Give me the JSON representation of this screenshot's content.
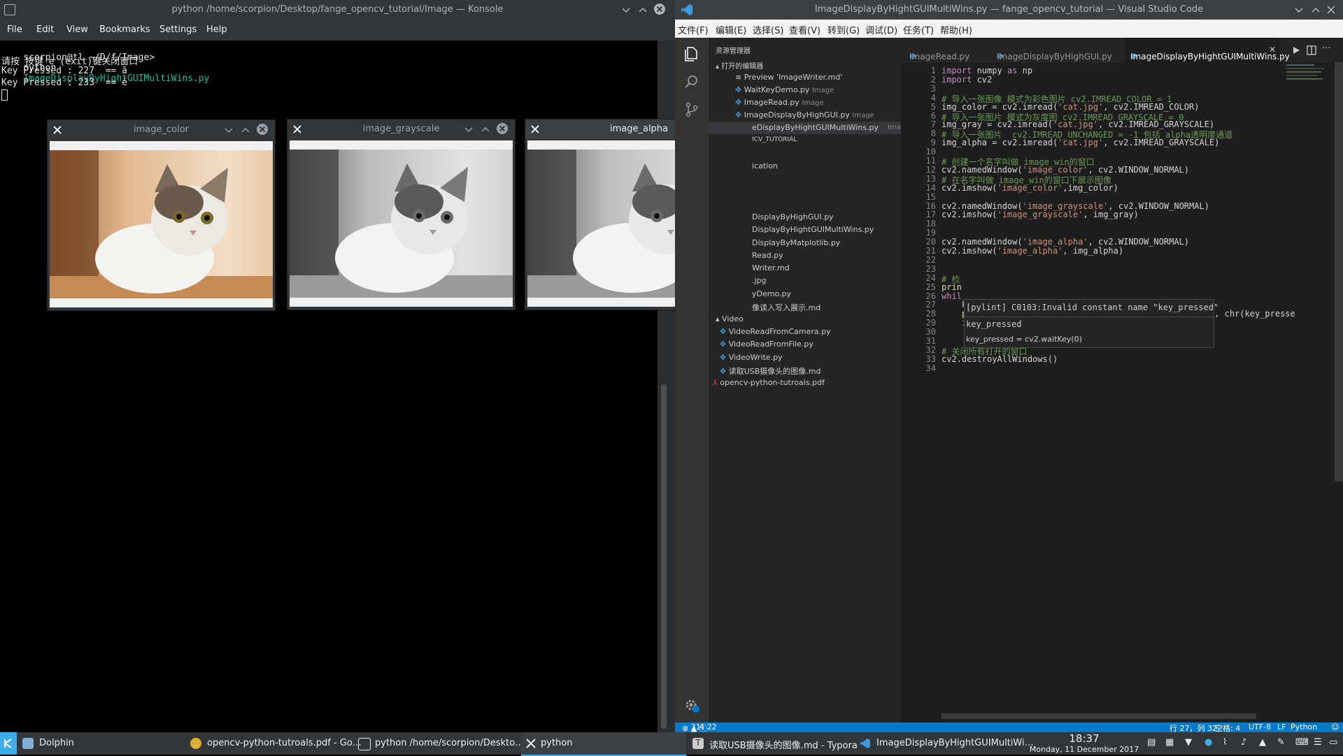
{
  "konsole": {
    "title": "python /home/scorpion/Desktop/fange_opencv_tutorial/Image — Konsole",
    "menu": [
      "File",
      "Edit",
      "View",
      "Bookmarks",
      "Settings",
      "Help"
    ],
    "prompt": "scorpion@tl ~/D/f/Image>",
    "command": "python",
    "command_arg": "ImageDisplayByHightGUIMultiWins.py",
    "output": [
      "请按 按键 e (exit)键关闭窗口",
      "Key Pressed : 227  == ã",
      "Key Pressed : 233  == é"
    ]
  },
  "windows": [
    {
      "title": "image_color",
      "mode": "color"
    },
    {
      "title": "image_grayscale",
      "mode": "gray"
    },
    {
      "title": "image_alpha",
      "mode": "gray"
    }
  ],
  "vscode": {
    "title": "ImageDisplayByHightGUIMultiWins.py — fange_opencv_tutorial — Visual Studio Code",
    "menu": [
      "文件(F)",
      "编辑(E)",
      "选择(S)",
      "查看(V)",
      "转到(G)",
      "调试(D)",
      "任务(T)",
      "帮助(H)"
    ],
    "sidebar": {
      "header": "资源管理器",
      "open_editors_label": "打开的编辑器",
      "open_editors": [
        {
          "name": "Preview 'ImageWriter.md'",
          "folder": ""
        },
        {
          "name": "WaitKeyDemo.py",
          "folder": "Image"
        },
        {
          "name": "ImageRead.py",
          "folder": "Image"
        },
        {
          "name": "ImageDisplayByHighGUI.py",
          "folder": "Image"
        },
        {
          "name": "eDisplayByHightGUIMultiWins.py",
          "folder": "Image"
        }
      ],
      "project_label": "ICV_TUTORIAL",
      "tree": [
        "ication",
        "DisplayByHighGUI.py",
        "DisplayByHightGUIMultiWins.py",
        "DisplayByMatplotlib.py",
        "Read.py",
        "Writer.md",
        ".jpg",
        "yDemo.py",
        "像读入写入展示.md",
        "Video",
        "VideoReadFromCamera.py",
        "VideoReadFromFile.py",
        "VideoWrite.py",
        "读取USB摄像头的图像.md",
        "opencv-python-tutroals.pdf"
      ]
    },
    "tabs": [
      "ImageRead.py",
      "ImageDisplayByHighGUI.py",
      "ImageDisplayByHightGUIMultiWins.py"
    ],
    "hover": {
      "line1": "[pylint] C0103:Invalid constant name \"key_pressed\"",
      "line2": "key_pressed",
      "line3": "key_pressed = cv2.waitKey(0)"
    },
    "status": {
      "errors": "31",
      "warnings": "4",
      "infos": "22",
      "position": "行 27，列 32",
      "spaces": "空格: 4",
      "encoding": "UTF-8",
      "eol": "LF",
      "language": "Python"
    }
  },
  "taskbar": {
    "items": [
      "Dolphin",
      "opencv-python-tutroals.pdf - Go…",
      "python  /home/scorpion/Deskto…",
      "python",
      "读取USB摄像头的图像.md - Typora",
      "ImageDisplayByHightGUIMultiWi…"
    ],
    "time": "18:37",
    "date": "Monday, 11 December 2017"
  }
}
